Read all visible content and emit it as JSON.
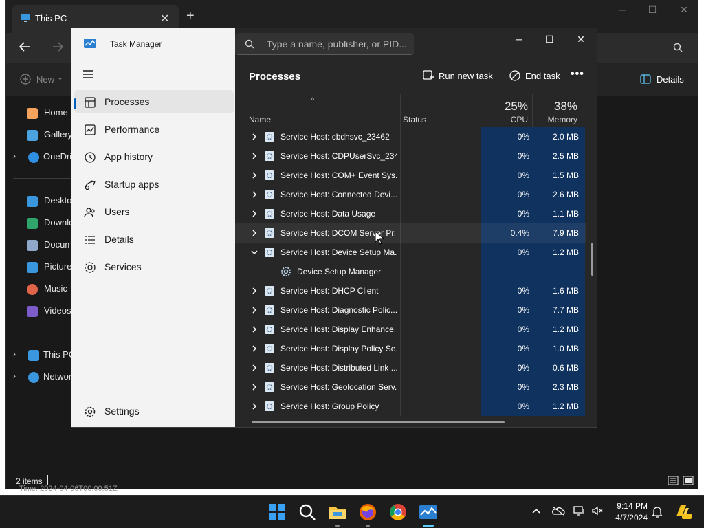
{
  "explorer": {
    "tab_title": "This PC",
    "new_label": "New",
    "details_label": "Details",
    "nav_items": [
      {
        "label": "Home"
      },
      {
        "label": "Gallery"
      },
      {
        "label": "OneDriv"
      },
      {
        "label": "Desktop"
      },
      {
        "label": "Downlo"
      },
      {
        "label": "Docum"
      },
      {
        "label": "Pictures"
      },
      {
        "label": "Music"
      },
      {
        "label": "Videos"
      },
      {
        "label": "This PC"
      },
      {
        "label": "Networ"
      }
    ],
    "status": "2 items",
    "bg_text": "Time: 2024-04-06T00:00:51Z"
  },
  "taskmanager": {
    "title": "Task Manager",
    "search_placeholder": "Type a name, publisher, or PID...",
    "nav": [
      {
        "label": "Processes",
        "icon": "processes-icon",
        "active": true
      },
      {
        "label": "Performance",
        "icon": "performance-icon"
      },
      {
        "label": "App history",
        "icon": "app-history-icon"
      },
      {
        "label": "Startup apps",
        "icon": "startup-apps-icon"
      },
      {
        "label": "Users",
        "icon": "users-icon"
      },
      {
        "label": "Details",
        "icon": "details-icon"
      },
      {
        "label": "Services",
        "icon": "services-icon"
      }
    ],
    "settings_label": "Settings",
    "heading": "Processes",
    "run_new_task": "Run new task",
    "end_task": "End task",
    "columns": {
      "name": "Name",
      "status": "Status",
      "cpu_pct": "25%",
      "cpu": "CPU",
      "mem_pct": "38%",
      "memory": "Memory"
    },
    "rows": [
      {
        "name": "Service Host: cbdhsvc_23462",
        "cpu": "0%",
        "mem": "2.0 MB"
      },
      {
        "name": "Service Host: CDPUserSvc_234...",
        "cpu": "0%",
        "mem": "2.5 MB"
      },
      {
        "name": "Service Host: COM+ Event Sys...",
        "cpu": "0%",
        "mem": "1.5 MB"
      },
      {
        "name": "Service Host: Connected Devi...",
        "cpu": "0%",
        "mem": "2.6 MB"
      },
      {
        "name": "Service Host: Data Usage",
        "cpu": "0%",
        "mem": "1.1 MB"
      },
      {
        "name": "Service Host: DCOM Server Pr...",
        "cpu": "0.4%",
        "mem": "7.9 MB"
      },
      {
        "name": "Service Host: Device Setup Ma...",
        "cpu": "0%",
        "mem": "1.2 MB",
        "expanded": true
      },
      {
        "name": "Device Setup Manager",
        "cpu": "",
        "mem": "",
        "child": true
      },
      {
        "name": "Service Host: DHCP Client",
        "cpu": "0%",
        "mem": "1.6 MB"
      },
      {
        "name": "Service Host: Diagnostic Polic...",
        "cpu": "0%",
        "mem": "7.7 MB"
      },
      {
        "name": "Service Host: Display Enhance...",
        "cpu": "0%",
        "mem": "1.2 MB"
      },
      {
        "name": "Service Host: Display Policy Se...",
        "cpu": "0%",
        "mem": "1.0 MB"
      },
      {
        "name": "Service Host: Distributed Link ...",
        "cpu": "0%",
        "mem": "0.6 MB"
      },
      {
        "name": "Service Host: Geolocation Serv...",
        "cpu": "0%",
        "mem": "2.3 MB"
      },
      {
        "name": "Service Host: Group Policy",
        "cpu": "0%",
        "mem": "1.2 MB"
      }
    ]
  },
  "taskbar": {
    "time": "9:14 PM",
    "date": "4/7/2024",
    "apps": [
      "start-icon",
      "search-icon",
      "file-explorer-icon",
      "firefox-icon",
      "chrome-icon",
      "task-manager-icon"
    ]
  },
  "colors": {
    "cpu_band": "#10325e",
    "accent": "#60cdff",
    "sidebar_bg": "#f3f3f3",
    "main_bg": "#272727"
  }
}
